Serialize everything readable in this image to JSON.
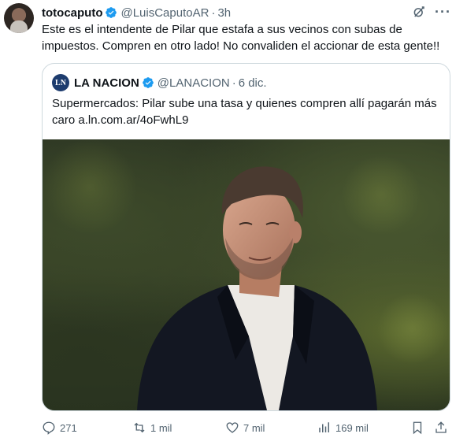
{
  "tweet": {
    "author_name": "totocaputo",
    "handle": "@LuisCaputoAR",
    "time": "3h",
    "text": "Este es el intendente de Pilar que estafa a sus vecinos con subas de impuestos. Compren en otro lado! No convaliden el accionar de  esta gente!!"
  },
  "quoted": {
    "logo_text": "LN",
    "author_name": "LA NACION",
    "handle": "@LANACION",
    "date": "6 dic.",
    "text": "Supermercados: Pilar sube una tasa y quienes compren allí pagarán más caro a.ln.com.ar/4oFwhL9"
  },
  "actions": {
    "replies": "271",
    "retweets": "1 mil",
    "likes": "7 mil",
    "views": "169 mil"
  },
  "colors": {
    "verified": "#1d9bf0",
    "muted": "#536471",
    "text": "#0f1419",
    "border": "#cfd9de"
  },
  "icons": [
    "verified-badge-icon",
    "grok-icon",
    "more-icon",
    "reply-icon",
    "retweet-icon",
    "like-icon",
    "views-icon",
    "bookmark-icon",
    "share-icon"
  ]
}
